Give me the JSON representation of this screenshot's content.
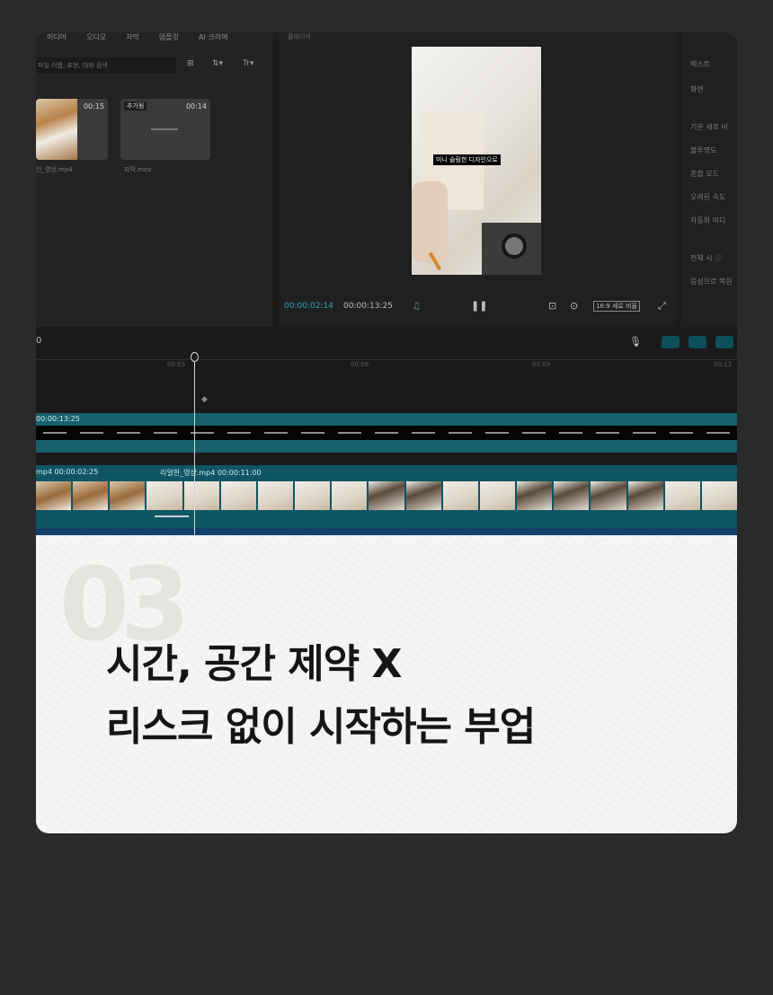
{
  "media": {
    "menu": [
      "미디어",
      "오디오",
      "자막",
      "템플릿",
      "AI 크리에"
    ],
    "search_placeholder": "파일 이름, 표현, 대화 검색",
    "tools": [
      "⊞",
      "⇅▾",
      "Tr▾"
    ],
    "thumbs": [
      {
        "duration": "00:15",
        "tag": "",
        "name": "인_영상.mp4"
      },
      {
        "duration": "00:14",
        "tag": "추가됨",
        "name": "자막.mov"
      }
    ]
  },
  "player": {
    "title": "플레이어",
    "subtitle": "미니 슬림한 디자인으로",
    "time_current": "00:00:02:14",
    "time_total": "00:00:13:25",
    "ratio": "16:9 세로 비율"
  },
  "props": {
    "items": [
      "텍스트",
      "화면",
      "기본 세로 비",
      "불투명도",
      "혼합 모드",
      "오래된 속도",
      "자동화 미디",
      "전체 시 ⓘ",
      "음성으로 복원"
    ]
  },
  "timeline": {
    "start": "0",
    "ticks": [
      "00:03",
      "00:06",
      "00:09",
      "00:12"
    ],
    "track1_label": "00:00:13:25",
    "clip1_label": "mp4  00:00:02:25",
    "clip2_label": "리얼한_영상.mp4   00:00:11:00"
  },
  "content": {
    "number": "03",
    "line1": "시간, 공간 제약 X",
    "line2": "리스크 없이 시작하는 부업"
  },
  "colors": {
    "background": "#2a2a2b",
    "accent": "#2aa7b8",
    "track": "#15606c",
    "headline": "#151515"
  }
}
